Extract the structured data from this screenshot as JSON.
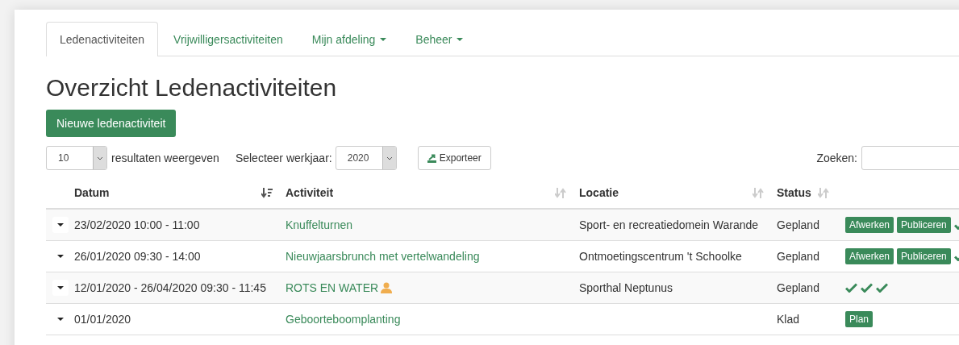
{
  "tabs": [
    {
      "label": "Ledenactiviteiten",
      "selected": true,
      "dropdown": false
    },
    {
      "label": "Vrijwilligersactiviteiten",
      "selected": false,
      "dropdown": false
    },
    {
      "label": "Mijn afdeling",
      "selected": false,
      "dropdown": true
    },
    {
      "label": "Beheer",
      "selected": false,
      "dropdown": true
    }
  ],
  "title": "Overzicht Ledenactiviteiten",
  "new_button": "Nieuwe ledenactiviteit",
  "page_size": {
    "value": "10",
    "label": "resultaten weergeven"
  },
  "year": {
    "label": "Selecteer werkjaar:",
    "value": "2020"
  },
  "export_button": "Exporteer",
  "search": {
    "label": "Zoeken:"
  },
  "table": {
    "columns": [
      {
        "label": "Datum",
        "sorted": true
      },
      {
        "label": "Activiteit",
        "sorted": false
      },
      {
        "label": "Locatie",
        "sorted": false
      },
      {
        "label": "Status",
        "sorted": false
      }
    ],
    "rows": [
      {
        "date": "23/02/2020 10:00 - 11:00",
        "activity": "Knuffelturnen",
        "volunteer": false,
        "location": "Sport- en recreatiedomein Warande",
        "status": "Gepland",
        "actions": [
          {
            "kind": "button",
            "label": "Afwerken"
          },
          {
            "kind": "button",
            "label": "Publiceren"
          },
          {
            "kind": "check"
          }
        ]
      },
      {
        "date": "26/01/2020 09:30 - 14:00",
        "activity": "Nieuwjaarsbrunch met vertelwandeling",
        "volunteer": false,
        "location": "Ontmoetingscentrum 't Schoolke",
        "status": "Gepland",
        "actions": [
          {
            "kind": "button",
            "label": "Afwerken"
          },
          {
            "kind": "button",
            "label": "Publiceren"
          },
          {
            "kind": "check"
          }
        ]
      },
      {
        "date": "12/01/2020 - 26/04/2020 09:30 - 11:45",
        "activity": "ROTS EN WATER",
        "volunteer": true,
        "location": "Sporthal Neptunus",
        "status": "Gepland",
        "actions": [
          {
            "kind": "check"
          },
          {
            "kind": "check"
          },
          {
            "kind": "check"
          }
        ]
      },
      {
        "date": "01/01/2020",
        "activity": "Geboorteboomplanting",
        "volunteer": false,
        "location": "",
        "status": "Klad",
        "actions": [
          {
            "kind": "button",
            "label": "Plan"
          }
        ]
      }
    ]
  }
}
